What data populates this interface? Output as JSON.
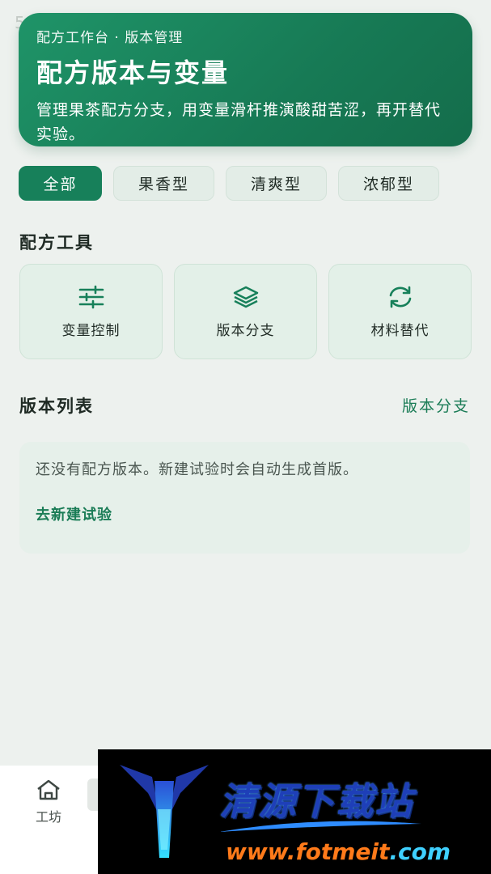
{
  "status": {
    "partial_text": "5"
  },
  "header": {
    "eyebrow": "配方工作台 · 版本管理",
    "title": "配方版本与变量",
    "description": "管理果茶配方分支，用变量滑杆推演酸甜苦涩，再开替代实验。"
  },
  "filters": [
    {
      "label": "全部",
      "active": true
    },
    {
      "label": "果香型",
      "active": false
    },
    {
      "label": "清爽型",
      "active": false
    },
    {
      "label": "浓郁型",
      "active": false
    }
  ],
  "tools_section": {
    "title": "配方工具",
    "items": [
      {
        "label": "变量控制",
        "icon": "sliders-icon"
      },
      {
        "label": "版本分支",
        "icon": "layers-icon"
      },
      {
        "label": "材料替代",
        "icon": "refresh-icon"
      }
    ]
  },
  "versions_section": {
    "title": "版本列表",
    "link": "版本分支",
    "empty_text": "还没有配方版本。新建试验时会自动生成首版。",
    "empty_action": "去新建试验"
  },
  "tabbar": {
    "home": {
      "label": "工坊",
      "icon": "home-icon"
    }
  },
  "watermark": {
    "title": "清源下载站",
    "url_prefix": "www.fotmeit",
    "url_suffix": ".com"
  },
  "colors": {
    "primary": "#17805a",
    "background": "#edf1ee",
    "card": "#e3f0e8"
  }
}
